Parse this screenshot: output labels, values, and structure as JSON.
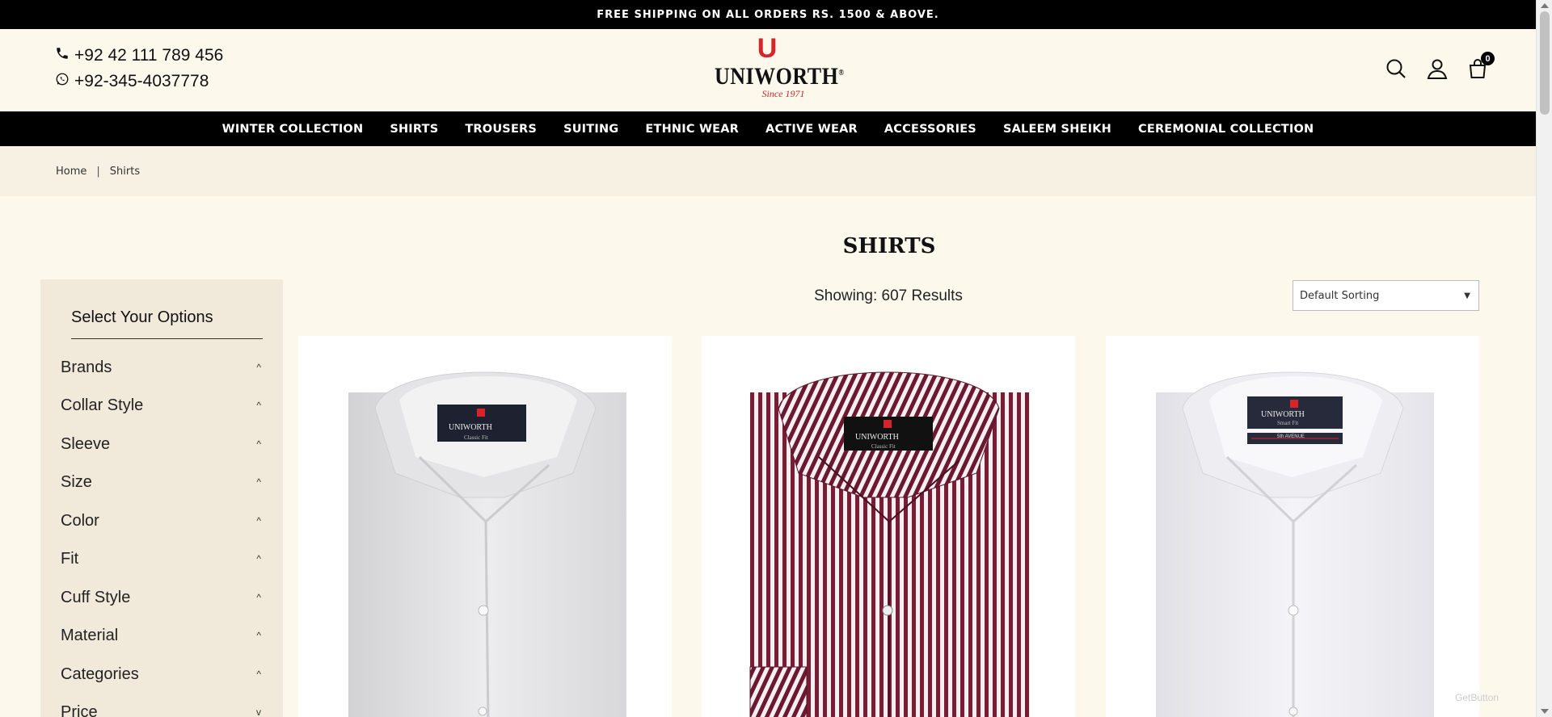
{
  "announcement": "FREE SHIPPING ON ALL ORDERS RS. 1500 & ABOVE.",
  "header": {
    "phone": "+92 42 111 789 456",
    "whatsapp": "+92-345-4037778",
    "logo": {
      "letter": "U",
      "name": "UNIWORTH",
      "mark": "®",
      "tagline": "Since 1971"
    },
    "cart_count": "0",
    "icons": [
      "phone-icon",
      "whatsapp-icon",
      "search-icon",
      "user-icon",
      "cart-icon"
    ]
  },
  "nav": [
    "WINTER COLLECTION",
    "SHIRTS",
    "TROUSERS",
    "SUITING",
    "ETHNIC WEAR",
    "ACTIVE WEAR",
    "ACCESSORIES",
    "SALEEM SHEIKH",
    "CEREMONIAL COLLECTION"
  ],
  "breadcrumb": {
    "home": "Home",
    "separator": "|",
    "current": "Shirts"
  },
  "page_title": "SHIRTS",
  "sidebar": {
    "title": "Select Your Options",
    "filters": [
      {
        "label": "Brands",
        "chevron": "^"
      },
      {
        "label": "Collar Style",
        "chevron": "^"
      },
      {
        "label": "Sleeve",
        "chevron": "^"
      },
      {
        "label": "Size",
        "chevron": "^"
      },
      {
        "label": "Color",
        "chevron": "^"
      },
      {
        "label": "Fit",
        "chevron": "^"
      },
      {
        "label": "Cuff Style",
        "chevron": "^"
      },
      {
        "label": "Material",
        "chevron": "^"
      },
      {
        "label": "Categories",
        "chevron": "^"
      },
      {
        "label": "Price",
        "chevron": "v"
      }
    ]
  },
  "results_text": "Showing: 607 Results",
  "sorting": {
    "selected": "Default Sorting"
  },
  "products": [
    {
      "image": "white classic fit shirt",
      "label_brand": "UNIWORTH",
      "label_fit": "Classic Fit"
    },
    {
      "image": "maroon striped classic fit shirt",
      "label_brand": "UNIWORTH",
      "label_fit": "Classic Fit"
    },
    {
      "image": "white smart fit shirt",
      "label_brand": "UNIWORTH",
      "label_fit": "Smart Fit",
      "label_line": "5th AVENUE"
    }
  ],
  "colors": {
    "black": "#000000",
    "cream": "#fdf8ec",
    "sidebar": "#f1eadb",
    "brand_red": "#d8232a",
    "stripe": "#7a1c35"
  },
  "watermark": "GetButton"
}
